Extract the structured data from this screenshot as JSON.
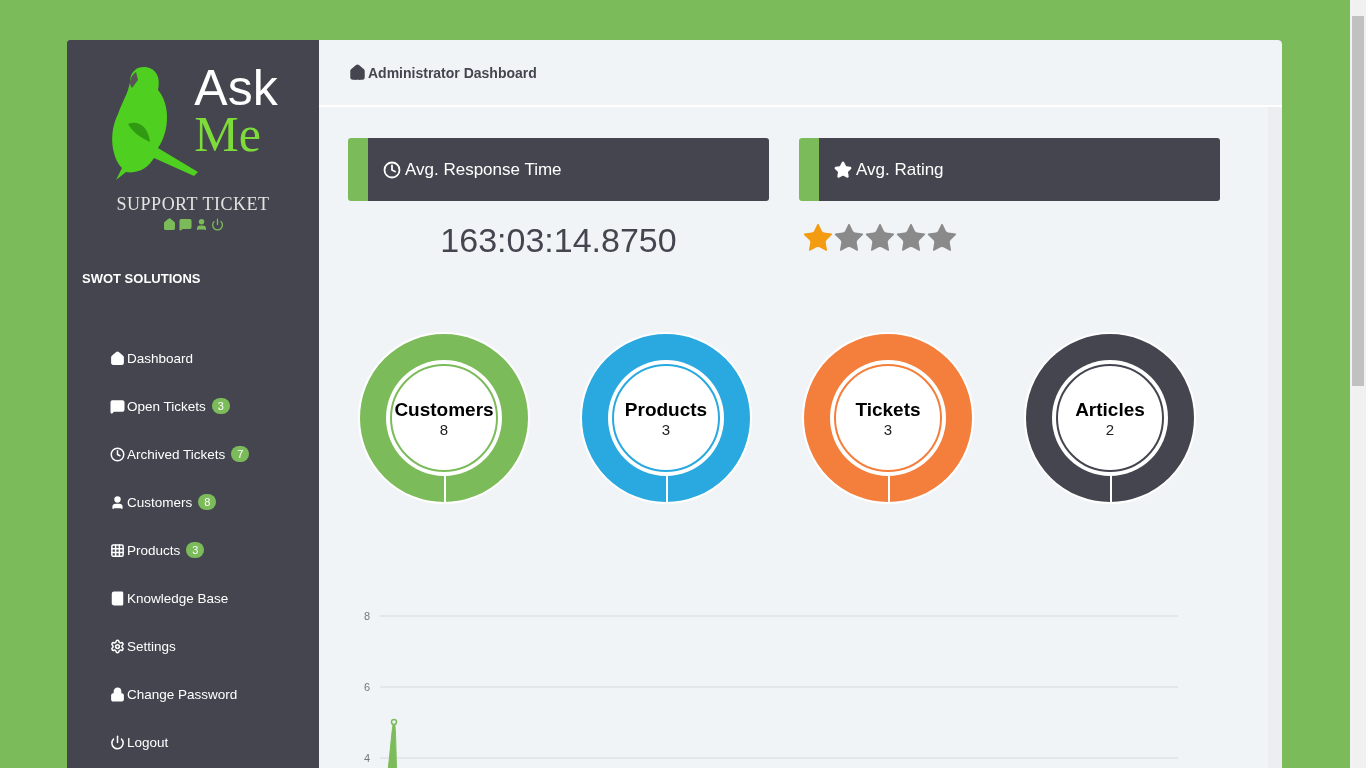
{
  "logo": {
    "line1": "Ask",
    "line2": "Me",
    "tagline": "SUPPORT TICKET"
  },
  "sidebar": {
    "company": "SWOT SOLUTIONS",
    "items": [
      {
        "label": "Dashboard"
      },
      {
        "label": "Open Tickets",
        "badge": "3"
      },
      {
        "label": "Archived Tickets",
        "badge": "7"
      },
      {
        "label": "Customers",
        "badge": "8"
      },
      {
        "label": "Products",
        "badge": "3"
      },
      {
        "label": "Knowledge Base"
      },
      {
        "label": "Settings"
      },
      {
        "label": "Change Password"
      },
      {
        "label": "Logout"
      }
    ]
  },
  "header": {
    "title": "Administrator Dashboard"
  },
  "cards": [
    {
      "title": "Avg. Response Time",
      "kind": "text",
      "value": "163:03:14.8750"
    },
    {
      "title": "Avg. Rating",
      "kind": "stars",
      "stars": 1
    }
  ],
  "stats": [
    {
      "label": "Customers",
      "value": "8",
      "color": "#7cbb5a"
    },
    {
      "label": "Products",
      "value": "3",
      "color": "#29a9e0"
    },
    {
      "label": "Tickets",
      "value": "3",
      "color": "#f47e3c"
    },
    {
      "label": "Articles",
      "value": "2",
      "color": "#44454f"
    }
  ],
  "chart": {
    "chart_data": {
      "type": "area",
      "grid": true,
      "ylim": [
        4,
        8
      ],
      "yticks": [
        4,
        6,
        8
      ],
      "series": [
        {
          "color": "#7cbb5a"
        }
      ]
    }
  }
}
